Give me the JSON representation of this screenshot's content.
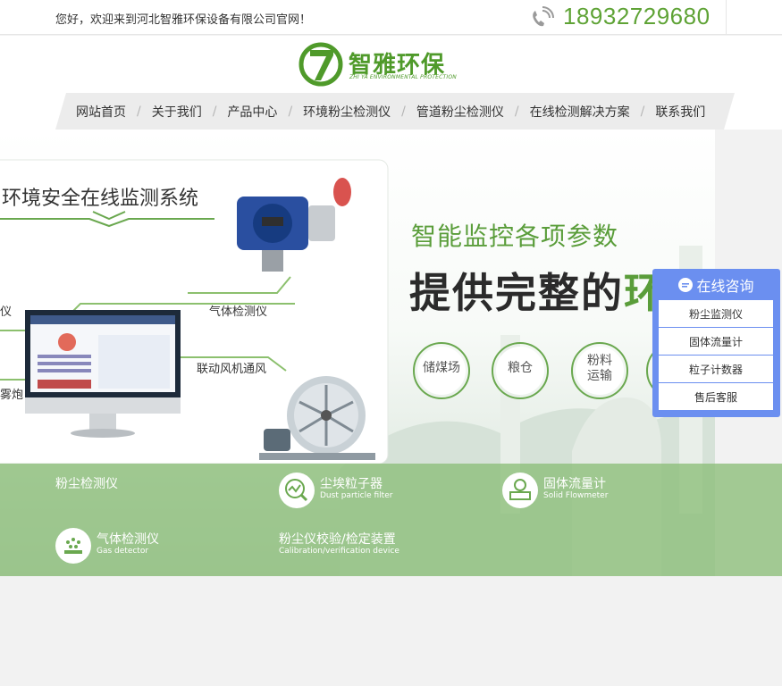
{
  "topbar": {
    "welcome": "您好，欢迎来到河北智雅环保设备有限公司官网！",
    "phone": "18932729680"
  },
  "logo": {
    "name": "智雅环保",
    "sub": "ZHI YA ENVIRONMENTAL PROTECTION",
    "mark": "7"
  },
  "nav": {
    "items": [
      "网站首页",
      "关于我们",
      "产品中心",
      "环境粉尘检测仪",
      "管道粉尘检测仪",
      "在线检测解决方案",
      "联系我们"
    ],
    "separator": "/"
  },
  "banner": {
    "title": "环境安全在线监测系统",
    "label_gas": "气体检测仪",
    "label_fan": "联动风机通风",
    "label_yi": "仪",
    "label_wupao": "雾炮",
    "slogan1": "智能监控各项参数",
    "slogan2": "提供完整的",
    "slogan2_tail": "环",
    "badges": [
      "储煤场",
      "粮仓",
      "粉料运输"
    ],
    "badge3_lines": [
      "粉料",
      "运输"
    ]
  },
  "categories": [
    {
      "title": "粉尘检测仪",
      "sub": ""
    },
    {
      "title": "尘埃粒子器",
      "sub": "Dust particle filter",
      "icon": "magnifier-chart-icon"
    },
    {
      "title": "固体流量计",
      "sub": "Solid Flowmeter",
      "icon": "flowmeter-icon"
    },
    {
      "title": "气体检测仪",
      "sub": "Gas detector",
      "icon": "gas-dots-icon"
    },
    {
      "title": "粉尘仪校验/检定装置",
      "sub": "Calibration/verification device"
    }
  ],
  "consult": {
    "title": "在线咨询",
    "items": [
      "粉尘监测仪",
      "固体流量计",
      "粒子计数器",
      "售后客服"
    ]
  },
  "colors": {
    "brand_green": "#5fa336",
    "consult_blue": "#6b8ff0",
    "strip_green": "#8cbe78"
  }
}
